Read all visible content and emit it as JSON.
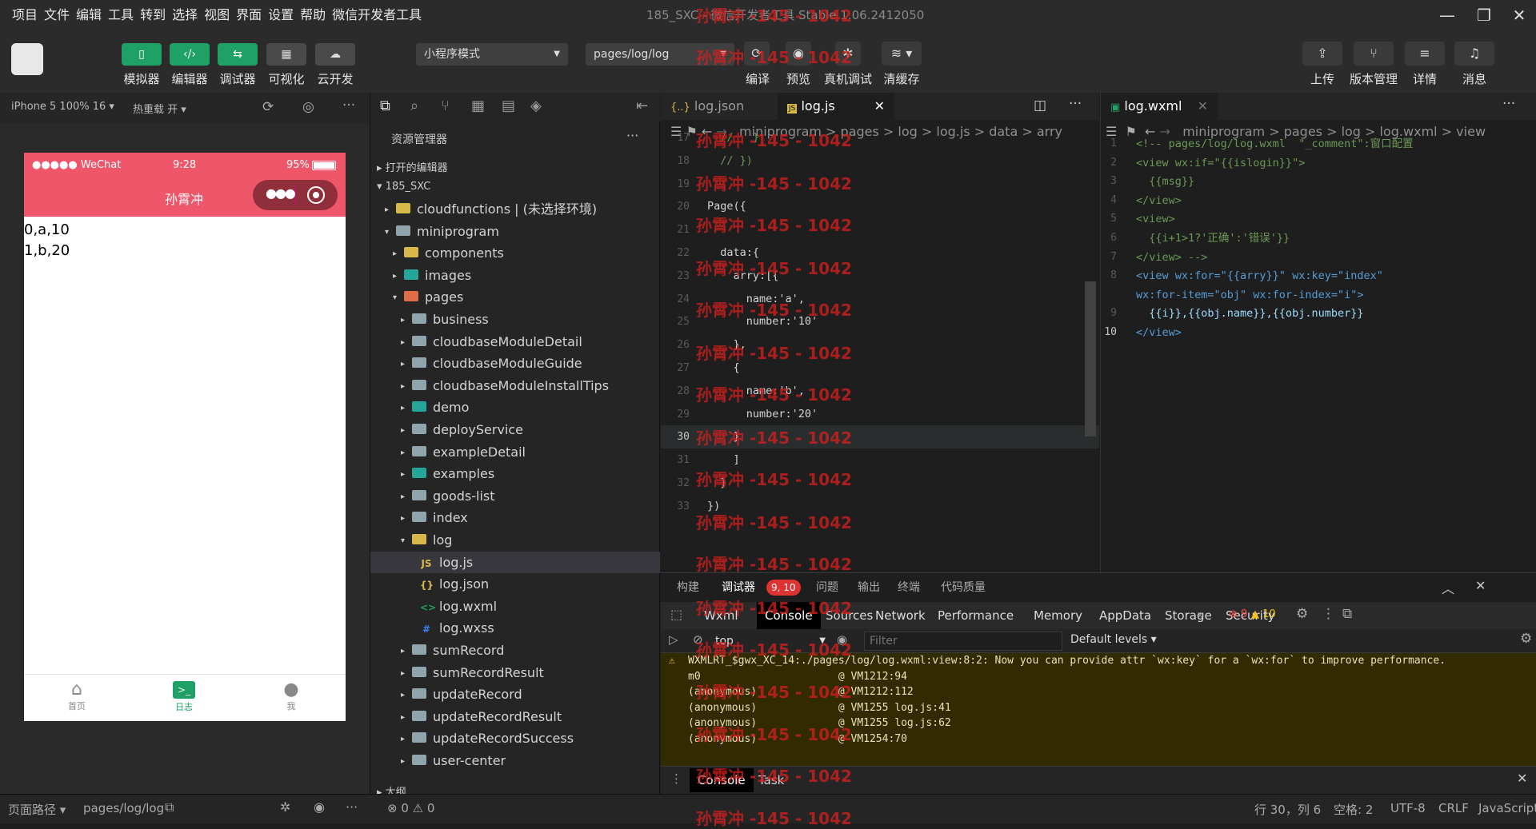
{
  "menubar": {
    "items": [
      "项目",
      "文件",
      "编辑",
      "工具",
      "转到",
      "选择",
      "视图",
      "界面",
      "设置",
      "帮助",
      "微信开发者工具"
    ],
    "title": "185_SXC - 微信开发者工具 Stable 1.06.2412050"
  },
  "toolbar": {
    "simulator": "模拟器",
    "editor": "编辑器",
    "debugger": "调试器",
    "visual": "可视化",
    "cloud": "云开发",
    "mode": "小程序模式",
    "page": "pages/log/log",
    "compile": "编译",
    "preview": "预览",
    "remote_debug": "真机调试",
    "clear_cache": "清缓存",
    "upload": "上传",
    "version": "版本管理",
    "details": "详情",
    "messages": "消息"
  },
  "simulator": {
    "device": "iPhone 5 100% 16",
    "hot_reload": "热重载 开",
    "status_signal": "●●●●● WeChat",
    "status_time": "9:28",
    "status_battery": "95%",
    "nav_title": "孙霄冲",
    "content_lines": [
      "0,a,10",
      "1,b,20"
    ],
    "tabs": [
      {
        "label": "首页"
      },
      {
        "label": "日志"
      },
      {
        "label": "我"
      }
    ]
  },
  "explorer": {
    "title": "资源管理器",
    "open_editors": "打开的编辑器",
    "project": "185_SXC",
    "outline": "大纲",
    "rows": [
      {
        "label": "cloudfunctions | (未选择环境)",
        "indent": 1,
        "arrow": "▸",
        "icon": "folder",
        "color": "yellow"
      },
      {
        "label": "miniprogram",
        "indent": 1,
        "arrow": "▾",
        "icon": "folder",
        "color": "gray"
      },
      {
        "label": "components",
        "indent": 2,
        "arrow": "▸",
        "icon": "folder",
        "color": "yellow"
      },
      {
        "label": "images",
        "indent": 2,
        "arrow": "▸",
        "icon": "folder",
        "color": "teal"
      },
      {
        "label": "pages",
        "indent": 2,
        "arrow": "▾",
        "icon": "folder",
        "color": "red"
      },
      {
        "label": "business",
        "indent": 3,
        "arrow": "▸",
        "icon": "folder",
        "color": "gray"
      },
      {
        "label": "cloudbaseModuleDetail",
        "indent": 3,
        "arrow": "▸",
        "icon": "folder",
        "color": "gray"
      },
      {
        "label": "cloudbaseModuleGuide",
        "indent": 3,
        "arrow": "▸",
        "icon": "folder",
        "color": "gray"
      },
      {
        "label": "cloudbaseModuleInstallTips",
        "indent": 3,
        "arrow": "▸",
        "icon": "folder",
        "color": "gray"
      },
      {
        "label": "demo",
        "indent": 3,
        "arrow": "▸",
        "icon": "folder",
        "color": "teal"
      },
      {
        "label": "deployService",
        "indent": 3,
        "arrow": "▸",
        "icon": "folder",
        "color": "gray"
      },
      {
        "label": "exampleDetail",
        "indent": 3,
        "arrow": "▸",
        "icon": "folder",
        "color": "gray"
      },
      {
        "label": "examples",
        "indent": 3,
        "arrow": "▸",
        "icon": "folder",
        "color": "teal"
      },
      {
        "label": "goods-list",
        "indent": 3,
        "arrow": "▸",
        "icon": "folder",
        "color": "gray"
      },
      {
        "label": "index",
        "indent": 3,
        "arrow": "▸",
        "icon": "folder",
        "color": "gray"
      },
      {
        "label": "log",
        "indent": 3,
        "arrow": "▾",
        "icon": "folder",
        "color": "yellow"
      },
      {
        "label": "log.js",
        "indent": 4,
        "arrow": "",
        "icon": "JS",
        "color": "#d7b848",
        "selected": true
      },
      {
        "label": "log.json",
        "indent": 4,
        "arrow": "",
        "icon": "{}",
        "color": "#d7b848"
      },
      {
        "label": "log.wxml",
        "indent": 4,
        "arrow": "",
        "icon": "<>",
        "color": "#1fa065"
      },
      {
        "label": "log.wxss",
        "indent": 4,
        "arrow": "",
        "icon": "#",
        "color": "#3b82f6"
      },
      {
        "label": "sumRecord",
        "indent": 3,
        "arrow": "▸",
        "icon": "folder",
        "color": "gray"
      },
      {
        "label": "sumRecordResult",
        "indent": 3,
        "arrow": "▸",
        "icon": "folder",
        "color": "gray"
      },
      {
        "label": "updateRecord",
        "indent": 3,
        "arrow": "▸",
        "icon": "folder",
        "color": "gray"
      },
      {
        "label": "updateRecordResult",
        "indent": 3,
        "arrow": "▸",
        "icon": "folder",
        "color": "gray"
      },
      {
        "label": "updateRecordSuccess",
        "indent": 3,
        "arrow": "▸",
        "icon": "folder",
        "color": "gray"
      },
      {
        "label": "user-center",
        "indent": 3,
        "arrow": "▸",
        "icon": "folder",
        "color": "gray"
      }
    ]
  },
  "editor1": {
    "tab1": "log.json",
    "tab2": "log.js",
    "breadcrumb": "miniprogram > pages > log > log.js > data > arry",
    "lines": [
      {
        "n": "17",
        "t": "  //   }"
      },
      {
        "n": "18",
        "t": "  // })"
      },
      {
        "n": "19",
        "t": ""
      },
      {
        "n": "20",
        "t": "Page({"
      },
      {
        "n": "21",
        "t": ""
      },
      {
        "n": "22",
        "t": "  data:{"
      },
      {
        "n": "23",
        "t": "    arry:[{"
      },
      {
        "n": "24",
        "t": "      name:'a',"
      },
      {
        "n": "25",
        "t": "      number:'10'"
      },
      {
        "n": "26",
        "t": "    },"
      },
      {
        "n": "27",
        "t": "    {"
      },
      {
        "n": "28",
        "t": "      name:'b',"
      },
      {
        "n": "29",
        "t": "      number:'20'"
      },
      {
        "n": "30",
        "t": "    }"
      },
      {
        "n": "31",
        "t": "    ]"
      },
      {
        "n": "32",
        "t": "  }"
      },
      {
        "n": "33",
        "t": "})"
      }
    ]
  },
  "editor2": {
    "tab": "log.wxml",
    "breadcrumb": "miniprogram > pages > log > log.wxml > view",
    "lines": [
      {
        "n": "1",
        "t": "<!-- pages/log/log.wxml  \"_comment\":窗口配置"
      },
      {
        "n": "2",
        "t": "<view wx:if=\"{{islogin}}\">"
      },
      {
        "n": "3",
        "t": "  {{msg}}"
      },
      {
        "n": "4",
        "t": "</view>"
      },
      {
        "n": "5",
        "t": "<view>"
      },
      {
        "n": "6",
        "t": "  {{i+1>1?'正确':'错误'}}"
      },
      {
        "n": "7",
        "t": "</view> -->"
      },
      {
        "n": "8",
        "t": "<view wx:for=\"{{arry}}\" wx:key=\"index\""
      },
      {
        "n": "",
        "t": "wx:for-item=\"obj\" wx:for-index=\"i\">"
      },
      {
        "n": "9",
        "t": "  {{i}},{{obj.name}},{{obj.number}}"
      },
      {
        "n": "10",
        "t": "</view>"
      }
    ]
  },
  "debug": {
    "tabs": [
      "构建",
      "调试器",
      "问题",
      "输出",
      "终端",
      "代码质量"
    ],
    "badge": "9, 10",
    "devtools": [
      "Wxml",
      "Console",
      "Sources",
      "Network",
      "Performance",
      "Memory",
      "AppData",
      "Storage",
      "Security"
    ],
    "errors": "9",
    "warnings": "10",
    "context": "top",
    "filter_placeholder": "Filter",
    "levels": "Default levels",
    "log": [
      "WXMLRT_$gwx_XC_14:./pages/log/log.wxml:view:8:2: Now you can provide attr `wx:key` for a `wx:for` to improve performance.",
      "m0                      @ VM1212:94",
      "(anonymous)             @ VM1212:112",
      "(anonymous)             @ VM1255 log.js:41",
      "(anonymous)             @ VM1255 log.js:62",
      "(anonymous)             @ VM1254:70"
    ],
    "drawer_console": "Console",
    "drawer_task": "Task"
  },
  "watermark": "孙霄冲 -145 - 1042",
  "statusbar": {
    "path_label": "页面路径",
    "path": "pages/log/log",
    "problems": "⊗ 0 ⚠ 0",
    "position": "行 30，列 6",
    "spaces": "空格: 2",
    "encoding": "UTF-8",
    "eol": "CRLF",
    "language": "JavaScript"
  }
}
